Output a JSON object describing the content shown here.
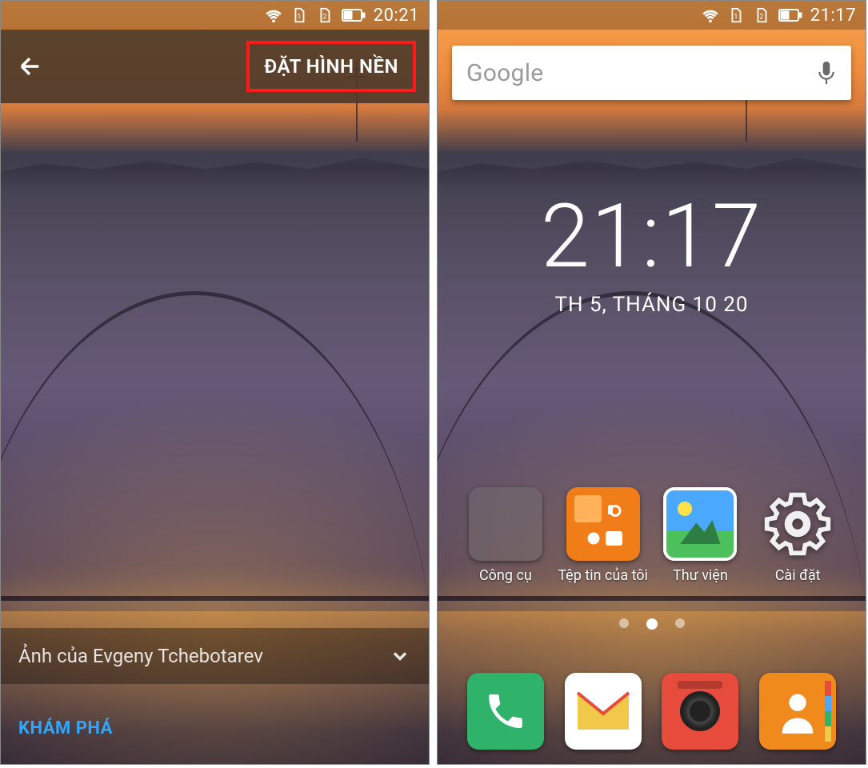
{
  "left": {
    "status": {
      "time": "20:21"
    },
    "appbar": {
      "set_wallpaper_label": "ĐẶT HÌNH NỀN"
    },
    "credit": {
      "text": "Ảnh của Evgeny Tchebotarev"
    },
    "explore_label": "KHÁM PHÁ"
  },
  "right": {
    "status": {
      "time": "21:17"
    },
    "search": {
      "placeholder": "Google"
    },
    "clock": {
      "time": "21:17",
      "date": "TH 5, THÁNG 10 20"
    },
    "apps": {
      "tools_label": "Công cụ",
      "files_label": "Tệp tin của tôi",
      "gallery_label": "Thư viện",
      "settings_label": "Cài đặt"
    }
  }
}
